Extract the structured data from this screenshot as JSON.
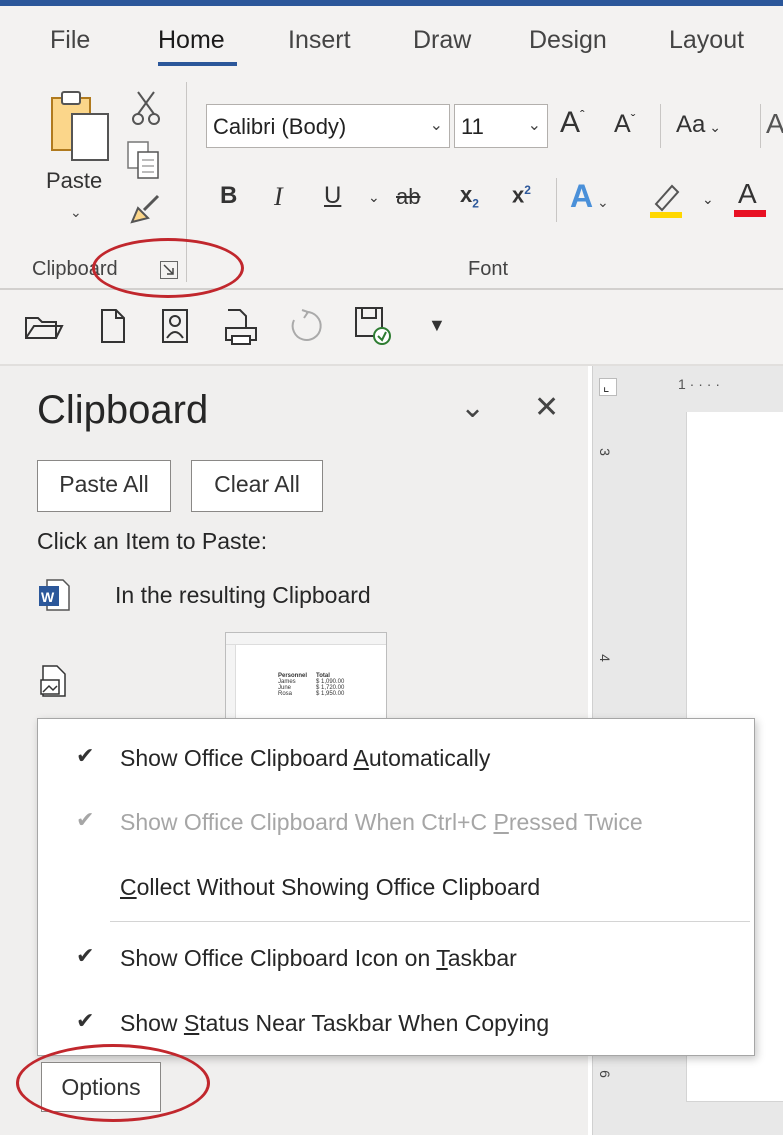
{
  "ribbon": {
    "tabs": [
      {
        "label": "File"
      },
      {
        "label": "Home",
        "active": true
      },
      {
        "label": "Insert"
      },
      {
        "label": "Draw"
      },
      {
        "label": "Design"
      },
      {
        "label": "Layout"
      }
    ],
    "clipboard_group": {
      "paste_label": "Paste",
      "group_label": "Clipboard"
    },
    "font_group": {
      "font_name": "Calibri (Body)",
      "font_size": "11",
      "grow_font": "A",
      "shrink_font": "A",
      "change_case": "Aa",
      "bold": "B",
      "italic": "I",
      "underline": "U",
      "strikethrough": "ab",
      "subscript": "x",
      "subscript_mark": "2",
      "superscript": "x",
      "superscript_mark": "2",
      "text_effects": "A",
      "font_color": "A",
      "group_label": "Font"
    },
    "colors": {
      "accent": "#2b579a",
      "highlight": "#ffd700",
      "font_color_bar": "#e81123",
      "annotation_red": "#c1272d"
    }
  },
  "clipboard_pane": {
    "title": "Clipboard",
    "paste_all_label": "Paste All",
    "clear_all_label": "Clear All",
    "instruction": "Click an Item to Paste:",
    "items": [
      {
        "icon": "word-document-icon",
        "text": "In the resulting Clipboard"
      },
      {
        "icon": "picture-icon",
        "text": "",
        "preview": {
          "headers": [
            "Personnel",
            "Total"
          ],
          "rows": [
            [
              "James",
              "$ 1,090.00"
            ],
            [
              "June",
              "$ 1,720.00"
            ],
            [
              "Rosa",
              "$ 1,950.00"
            ]
          ]
        }
      }
    ],
    "options_label": "Options"
  },
  "ruler": {
    "vertical_marks": [
      "3",
      "4",
      "6"
    ],
    "horizontal_mark": "1"
  },
  "options_menu": {
    "items": [
      {
        "checked": true,
        "disabled": false,
        "pre": "Show Office Clipboard ",
        "key": "A",
        "post": "utomatically"
      },
      {
        "checked": true,
        "disabled": true,
        "pre": "Show Office Clipboard When Ctrl+C ",
        "key": "P",
        "post": "ressed Twice"
      },
      {
        "checked": false,
        "disabled": false,
        "pre": "",
        "key": "C",
        "post": "ollect Without Showing Office Clipboard"
      },
      {
        "checked": true,
        "disabled": false,
        "pre": "Show Office Clipboard Icon on ",
        "key": "T",
        "post": "askbar"
      },
      {
        "checked": true,
        "disabled": false,
        "pre": "Show ",
        "key": "S",
        "post": "tatus Near Taskbar When Copying"
      }
    ]
  }
}
